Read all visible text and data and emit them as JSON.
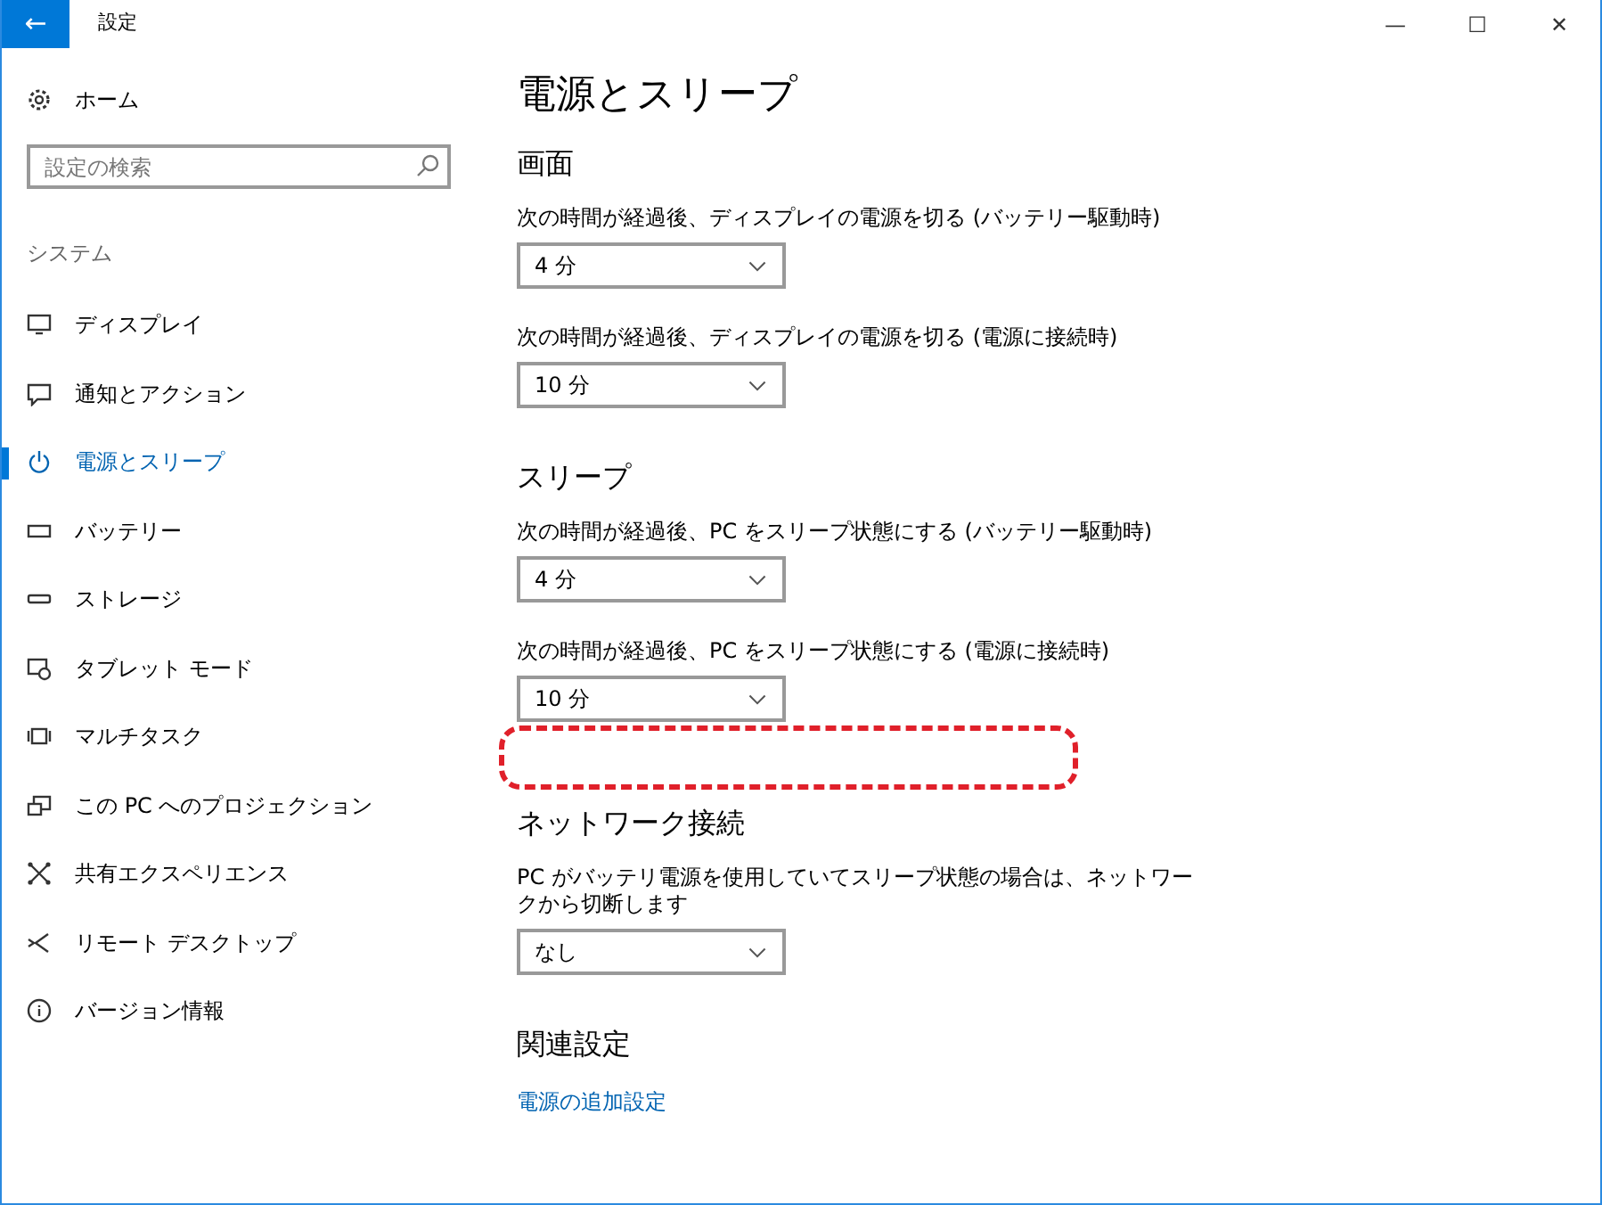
{
  "window": {
    "title": "設定",
    "back": "←",
    "controls": [
      "—",
      "☐",
      "✕"
    ]
  },
  "sidebar": {
    "home": "ホーム",
    "search": {
      "placeholder": "設定の検索"
    },
    "section": "システム",
    "items": [
      {
        "label": "ディスプレイ",
        "selected": false
      },
      {
        "label": "通知とアクション",
        "selected": false
      },
      {
        "label": "電源とスリープ",
        "selected": true
      },
      {
        "label": "バッテリー",
        "selected": false
      },
      {
        "label": "ストレージ",
        "selected": false
      },
      {
        "label": "タブレット モード",
        "selected": false
      },
      {
        "label": "マルチタスク",
        "selected": false
      },
      {
        "label": "この PC へのプロジェクション",
        "selected": false
      },
      {
        "label": "共有エクスペリエンス",
        "selected": false
      },
      {
        "label": "リモート デスクトップ",
        "selected": false
      },
      {
        "label": "バージョン情報",
        "selected": false
      }
    ]
  },
  "page": {
    "title": "電源とスリープ",
    "sections": [
      {
        "heading": "画面",
        "settings": [
          {
            "label": "次の時間が経過後、ディスプレイの電源を切る (バッテリー駆動時)",
            "value": "4 分"
          },
          {
            "label": "次の時間が経過後、ディスプレイの電源を切る (電源に接続時)",
            "value": "10 分"
          }
        ]
      },
      {
        "heading": "スリープ",
        "settings": [
          {
            "label": "次の時間が経過後、PC をスリープ状態にする (バッテリー駆動時)",
            "value": "4 分"
          },
          {
            "label": "次の時間が経過後、PC をスリープ状態にする (電源に接続時)",
            "value": "10 分"
          }
        ],
        "annotation": {
          "kind": "dashed-highlight"
        }
      },
      {
        "heading": "ネットワーク接続",
        "settings": [
          {
            "label": "PC がバッテリ電源を使用していてスリープ状態の場合は、ネットワークから切断します",
            "value": "なし"
          }
        ]
      }
    ],
    "related": {
      "heading": "関連設定",
      "link": "電源の追加設定"
    }
  }
}
